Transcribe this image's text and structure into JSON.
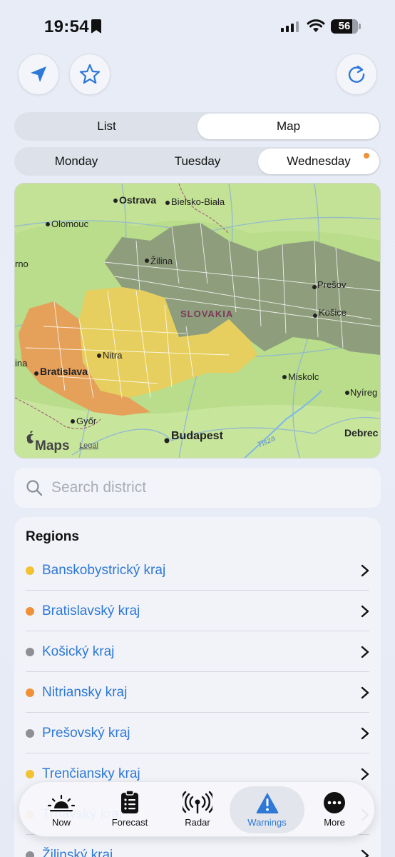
{
  "status": {
    "time": "19:54",
    "battery": "56"
  },
  "toolbar": {
    "locate_icon": "location-arrow-icon",
    "favorite_icon": "star-icon",
    "refresh_icon": "refresh-icon"
  },
  "view_toggle": {
    "options": [
      "List",
      "Map"
    ],
    "selected": "Map"
  },
  "days": {
    "options": [
      "Monday",
      "Tuesday",
      "Wednesday"
    ],
    "selected": "Wednesday"
  },
  "map": {
    "country": "SLOVAKIA",
    "cities": [
      "Ostrava",
      "Bielsko-Biała",
      "Olomouc",
      "rno",
      "Žilina",
      "Prešov",
      "Košice",
      "Nitra",
      "Bratislava",
      "ina",
      "Miskolc",
      "Nyíreg",
      "Győr",
      "Budapest",
      "Debrec"
    ],
    "river": "Tisza",
    "attribution": "Maps",
    "legal": "Legal"
  },
  "search": {
    "placeholder": "Search district"
  },
  "regions": {
    "title": "Regions",
    "items": [
      {
        "name": "Banskobystrický kraj",
        "color": "#f2c230"
      },
      {
        "name": "Bratislavský kraj",
        "color": "#f0913a"
      },
      {
        "name": "Košický kraj",
        "color": "#8e8e93"
      },
      {
        "name": "Nitriansky kraj",
        "color": "#f0913a"
      },
      {
        "name": "Prešovský kraj",
        "color": "#8e8e93"
      },
      {
        "name": "Trenčiansky kraj",
        "color": "#f2c230"
      },
      {
        "name": "Trnavský kraj",
        "color": "#f0913a"
      },
      {
        "name": "Žilinský kraj",
        "color": "#8e8e93"
      }
    ]
  },
  "tabs": [
    {
      "label": "Now",
      "icon": "sunrise-icon"
    },
    {
      "label": "Forecast",
      "icon": "clipboard-list-icon"
    },
    {
      "label": "Radar",
      "icon": "radar-waves-icon"
    },
    {
      "label": "Warnings",
      "icon": "warning-triangle-icon"
    },
    {
      "label": "More",
      "icon": "more-dots-icon"
    }
  ],
  "active_tab": "Warnings",
  "colors": {
    "accent": "#2e78d6",
    "warning_orange": "#f0913a",
    "warning_yellow": "#f2c230",
    "no_warning": "#8e8e93"
  }
}
